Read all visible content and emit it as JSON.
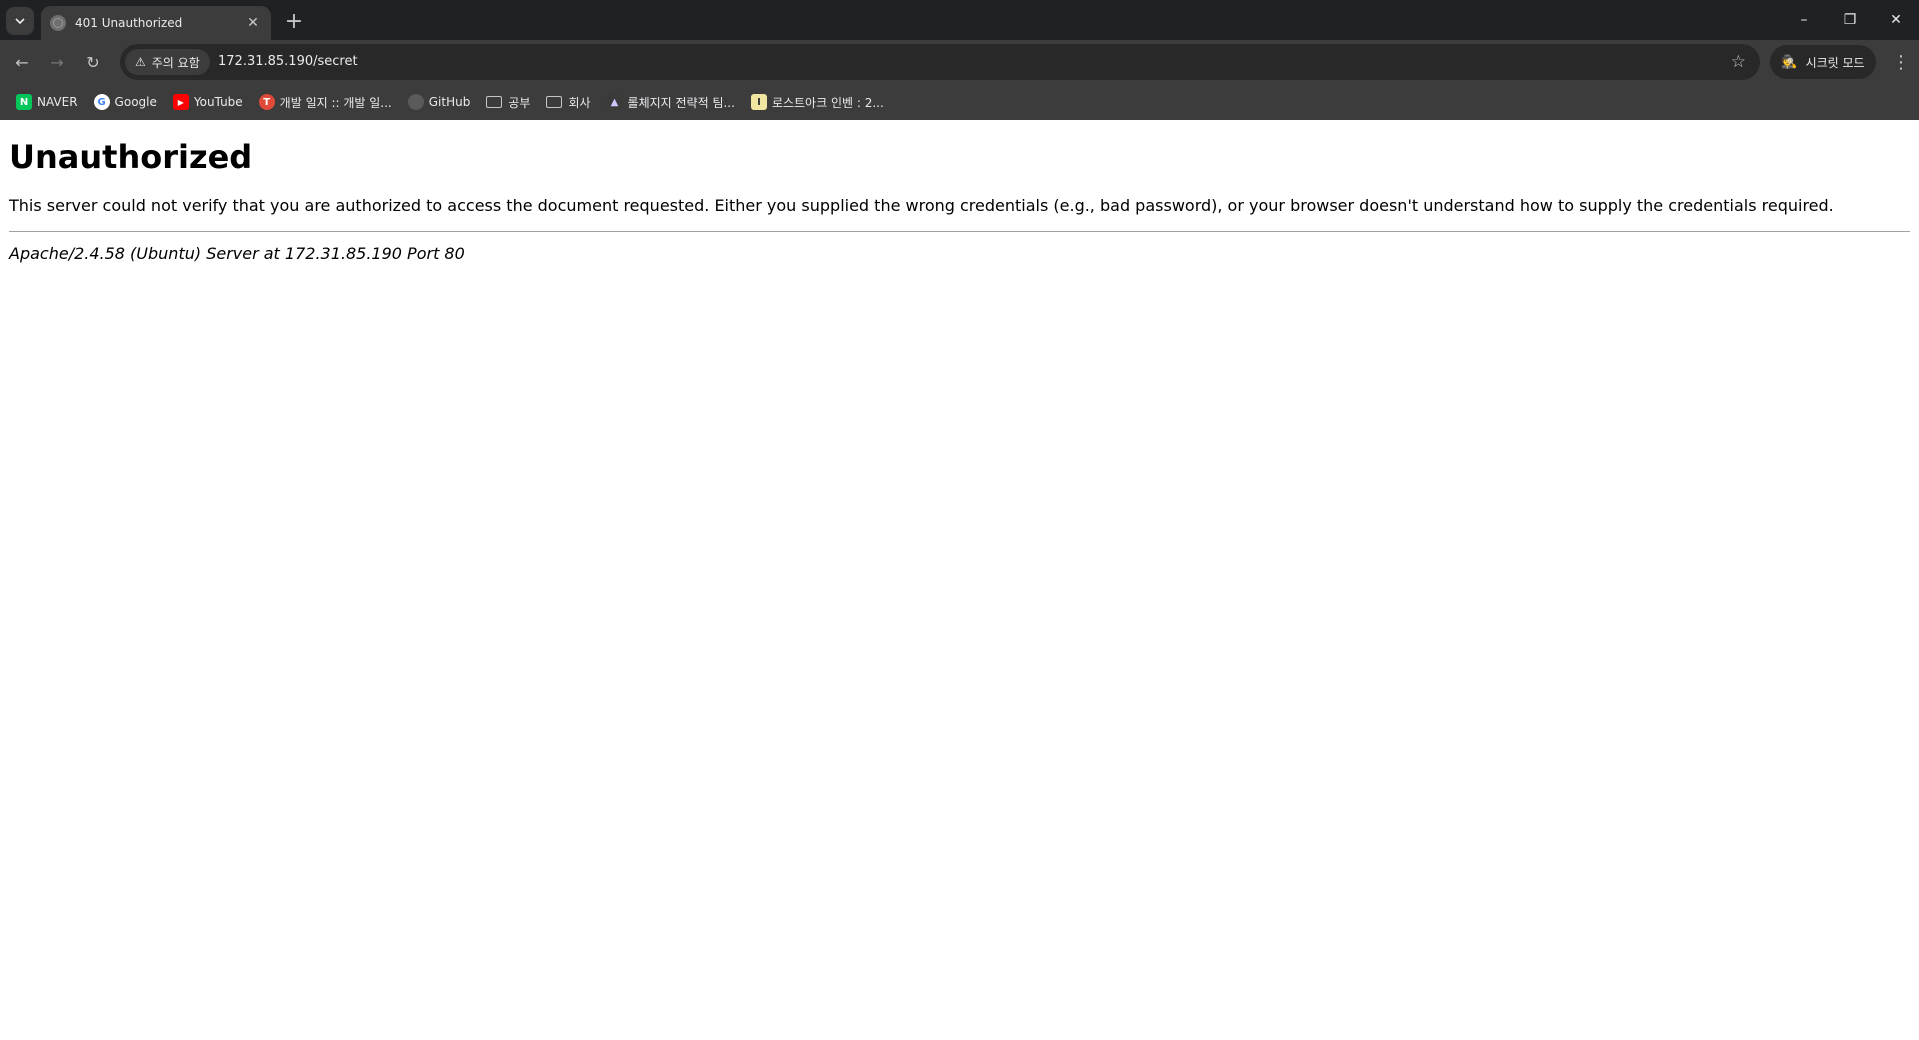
{
  "browser": {
    "tab": {
      "title": "401 Unauthorized",
      "close_icon": "close-icon"
    },
    "new_tab_label": "+",
    "window_controls": {
      "minimize": "–",
      "restore": "❐",
      "close": "✕"
    },
    "toolbar": {
      "back": "←",
      "forward": "→",
      "reload": "↻",
      "security_chip_icon": "⚠",
      "security_chip": "주의 요함",
      "url": "172.31.85.190/secret",
      "star": "☆",
      "incognito_icon": "🕵",
      "incognito_label": "시크릿 모드",
      "menu": "⋮"
    },
    "bookmarks": [
      {
        "label": "NAVER",
        "icon": "naver-icon",
        "icon_text": "N",
        "color": "#03c75a"
      },
      {
        "label": "Google",
        "icon": "google-icon",
        "icon_text": "G",
        "color": "#4285f4"
      },
      {
        "label": "YouTube",
        "icon": "youtube-icon",
        "icon_text": "▶",
        "color": "#ff0000"
      },
      {
        "label": "개발 일지 :: 개발 일...",
        "icon": "tistory-icon",
        "icon_text": "T",
        "color": "#e04a3a"
      },
      {
        "label": "GitHub",
        "icon": "github-icon",
        "icon_text": "",
        "color": "#5a5a5a"
      },
      {
        "label": "공부",
        "icon": "folder-icon",
        "icon_text": "",
        "color": ""
      },
      {
        "label": "회사",
        "icon": "folder-icon",
        "icon_text": "",
        "color": ""
      },
      {
        "label": "롤체지지 전략적 팀...",
        "icon": "lolchess-icon",
        "icon_text": "▲",
        "color": "#8a5cff"
      },
      {
        "label": "로스트아크 인벤 : 2...",
        "icon": "inven-icon",
        "icon_text": "I",
        "color": "#c8a400"
      }
    ]
  },
  "page": {
    "heading": "Unauthorized",
    "message": "This server could not verify that you are authorized to access the document requested. Either you supplied the wrong credentials (e.g., bad password), or your browser doesn't understand how to supply the credentials required.",
    "signature": "Apache/2.4.58 (Ubuntu) Server at 172.31.85.190 Port 80"
  }
}
